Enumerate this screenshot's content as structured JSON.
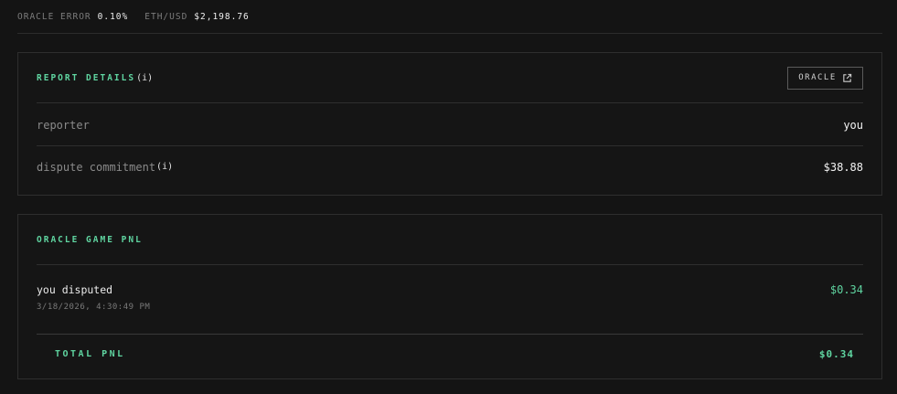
{
  "topbar": {
    "oracle_error_label": "ORACLE ERROR",
    "oracle_error_value": "0.10%",
    "eth_usd_label": "ETH/USD",
    "eth_usd_value": "$2,198.76"
  },
  "report_details": {
    "title": "REPORT DETAILS",
    "info_marker": "(i)",
    "oracle_button_label": "ORACLE",
    "oracle_button_icon": "external-link-icon",
    "rows": [
      {
        "key": "reporter",
        "value": "you"
      },
      {
        "key": "dispute commitment",
        "info": "(i)",
        "value": "$38.88"
      }
    ]
  },
  "oracle_game_pnl": {
    "title": "ORACLE GAME PNL",
    "entries": [
      {
        "label": "you disputed",
        "timestamp": "3/18/2026, 4:30:49 PM",
        "amount": "$0.34"
      }
    ],
    "total_label": "TOTAL PNL",
    "total_value": "$0.34"
  },
  "colors": {
    "background": "#141414",
    "accent_green": "#5fd4a0",
    "border": "#2e2e2e"
  }
}
